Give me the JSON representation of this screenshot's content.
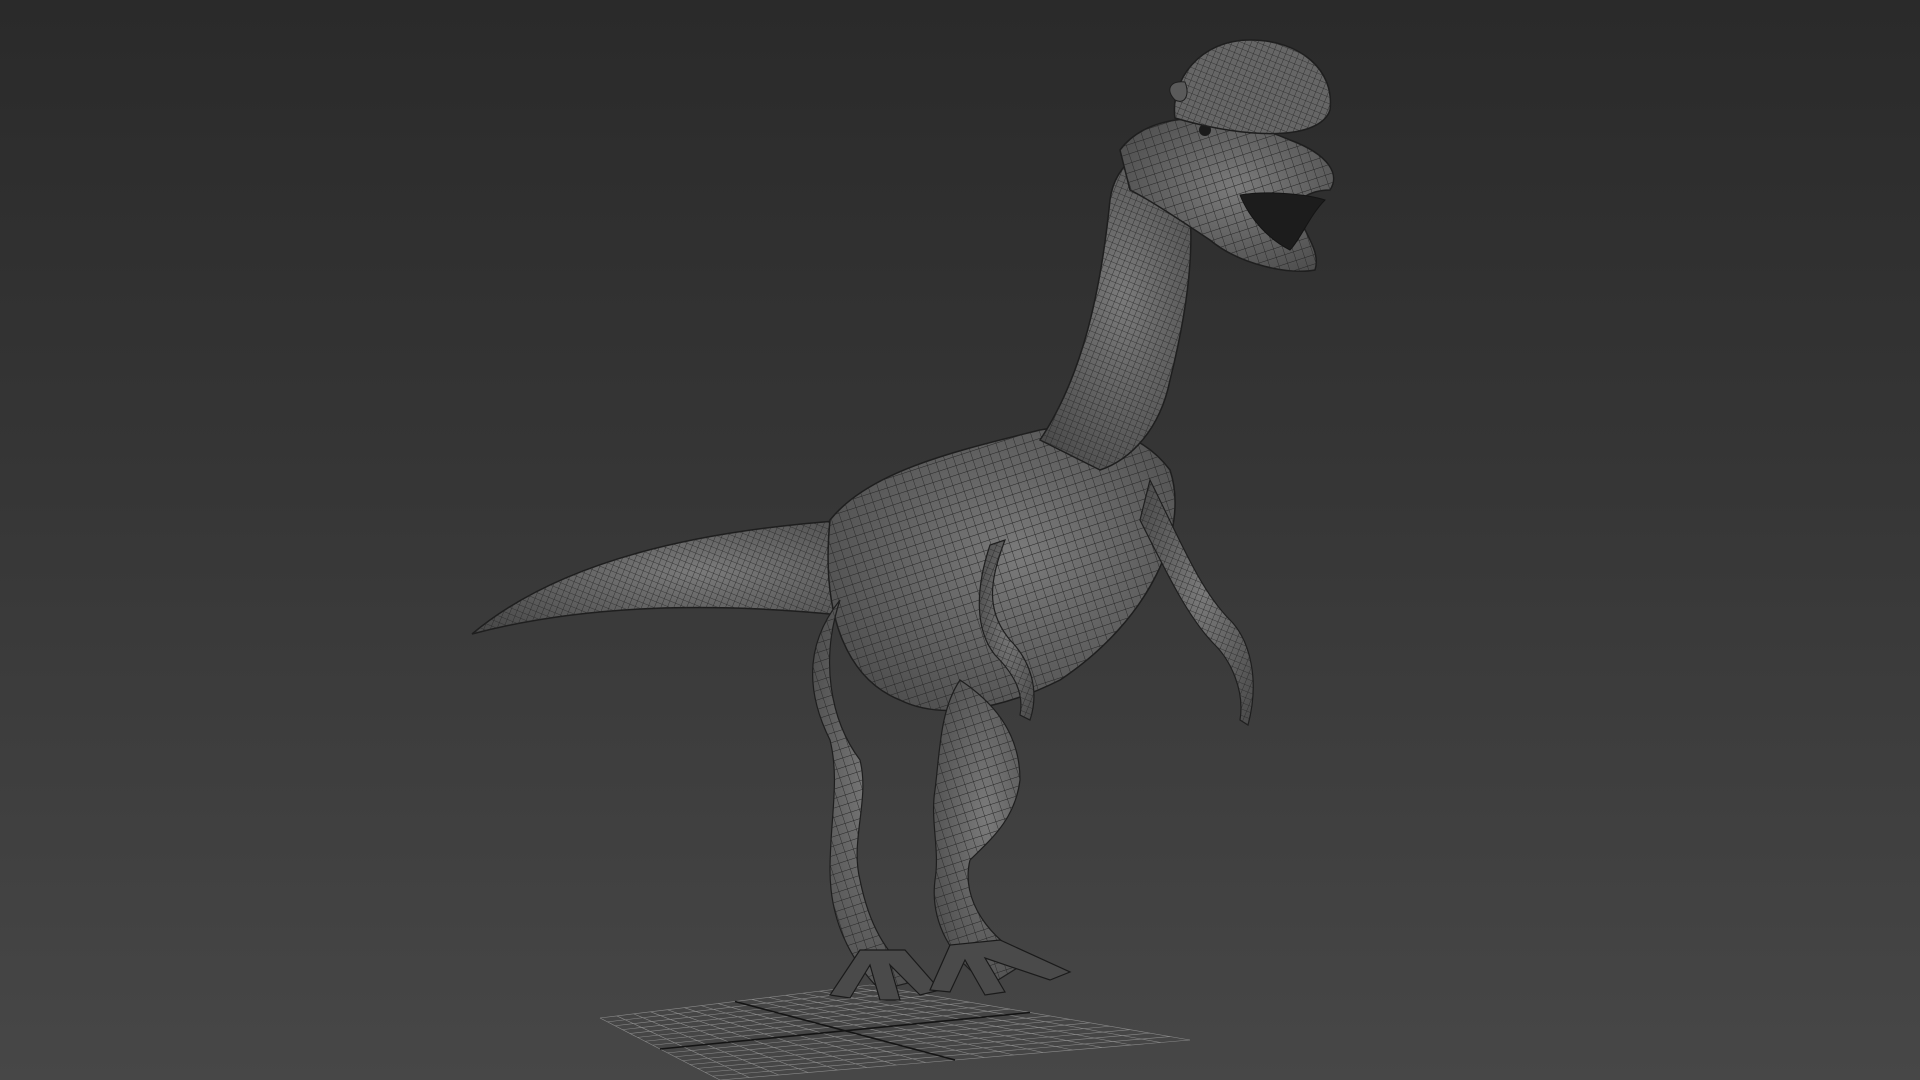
{
  "viewport": {
    "background_top": "#2a2a2a",
    "background_bottom": "#474747",
    "grid_color": "#8a8a8a",
    "axis_color": "#141414",
    "mesh_fill": "#5e5e5e",
    "mesh_wire": "#262626"
  },
  "model": {
    "subject": "dinosaur",
    "display_mode": "wireframe-on-shaded",
    "icon": "dinosaur-mesh"
  }
}
